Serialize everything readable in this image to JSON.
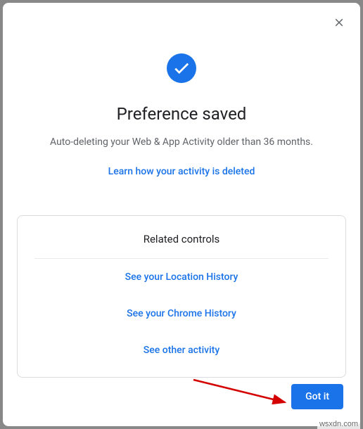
{
  "dialog": {
    "title": "Preference saved",
    "subtitle": "Auto-deleting your Web & App Activity older than 36 months.",
    "learn_link": "Learn how your activity is deleted"
  },
  "related": {
    "heading": "Related controls",
    "links": [
      "See your Location History",
      "See your Chrome History",
      "See other activity"
    ]
  },
  "buttons": {
    "got_it": "Got it"
  },
  "colors": {
    "accent": "#1a73e8"
  },
  "watermark": "wsxdn.com"
}
